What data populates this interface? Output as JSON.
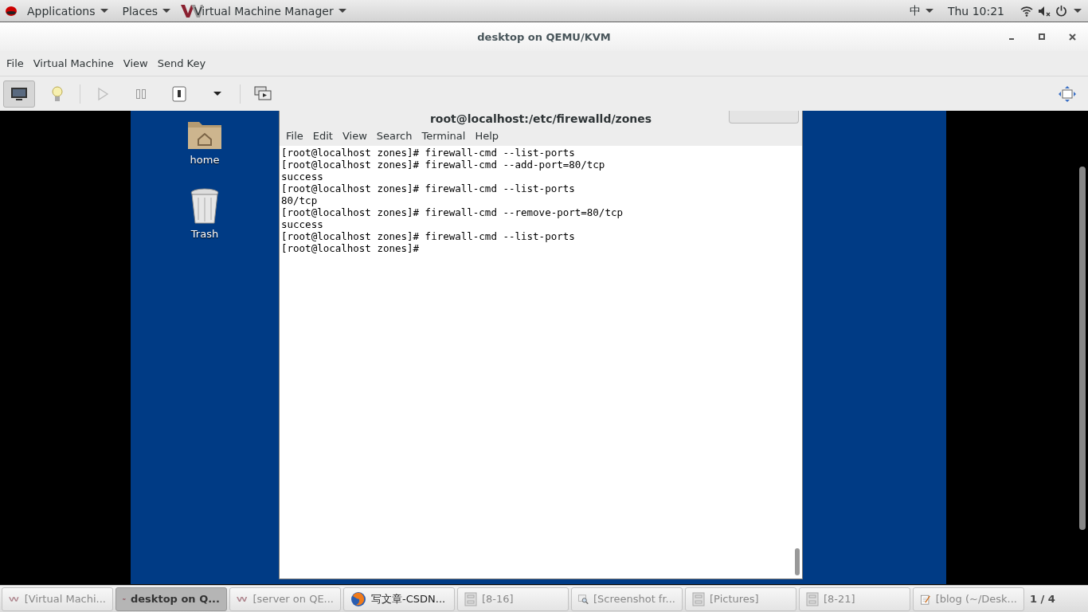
{
  "top_bar": {
    "applications": "Applications",
    "places": "Places",
    "app_name": "Virtual Machine Manager",
    "input_method": "中",
    "clock": "Thu 10:21"
  },
  "window": {
    "title": "desktop on QEMU/KVM"
  },
  "menu": [
    "File",
    "Virtual Machine",
    "View",
    "Send Key"
  ],
  "toolbar": {
    "console_selected": true
  },
  "desktop_icons": [
    {
      "label": "home",
      "kind": "folder"
    },
    {
      "label": "Trash",
      "kind": "trash"
    }
  ],
  "terminal": {
    "title": "root@localhost:/etc/firewalld/zones",
    "menu": [
      "File",
      "Edit",
      "View",
      "Search",
      "Terminal",
      "Help"
    ],
    "lines": [
      "[root@localhost zones]# firewall-cmd --list-ports",
      "[root@localhost zones]# firewall-cmd --add-port=80/tcp",
      "success",
      "[root@localhost zones]# firewall-cmd --list-ports",
      "80/tcp",
      "[root@localhost zones]# firewall-cmd --remove-port=80/tcp",
      "success",
      "[root@localhost zones]# firewall-cmd --list-ports",
      "[root@localhost zones]#"
    ]
  },
  "taskbar": {
    "items": [
      {
        "label": "[Virtual Machi...",
        "kind": "vm",
        "selected": false
      },
      {
        "label": "desktop on Q...",
        "kind": "vm",
        "selected": true
      },
      {
        "label": "[server on QE...",
        "kind": "vm",
        "selected": false
      },
      {
        "label": "写文章-CSDN...",
        "kind": "browser",
        "selected": false
      },
      {
        "label": "[8-16]",
        "kind": "files",
        "selected": false
      },
      {
        "label": "[Screenshot fr...",
        "kind": "screenshot",
        "selected": false
      },
      {
        "label": "[Pictures]",
        "kind": "files",
        "selected": false
      },
      {
        "label": "[8-21]",
        "kind": "files",
        "selected": false
      },
      {
        "label": "[blog (~/Desk...",
        "kind": "editor",
        "selected": false
      }
    ],
    "pager": "1 / 4"
  }
}
